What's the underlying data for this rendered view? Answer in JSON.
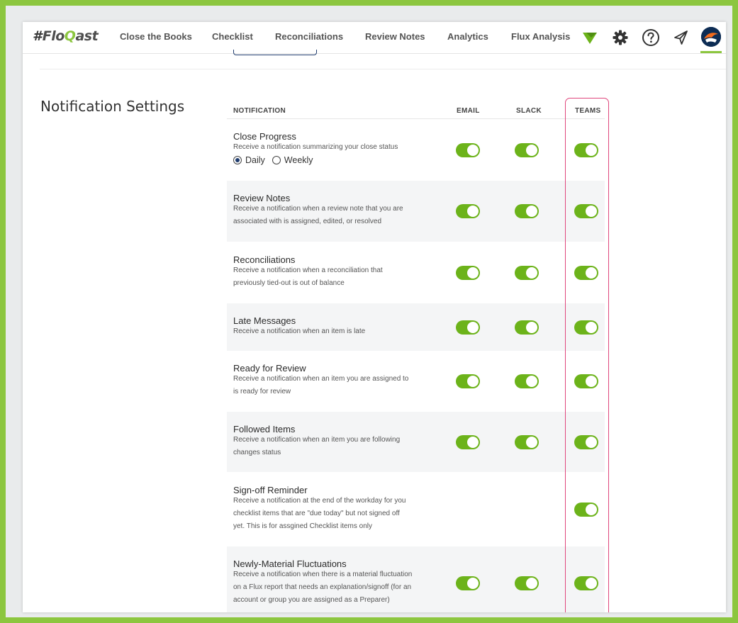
{
  "app": {
    "logo_text_prefix": "#",
    "logo_text_main": "Flo",
    "logo_text_q": "Q",
    "logo_text_rest": "ast"
  },
  "nav": {
    "items": [
      "Close the Books",
      "Checklist",
      "Reconciliations",
      "Review Notes",
      "Analytics",
      "Flux Analysis"
    ],
    "icons": [
      "floqast-chevron-icon",
      "gear-icon",
      "help-icon",
      "send-icon",
      "avatar"
    ]
  },
  "page": {
    "section_title": "Notification Settings"
  },
  "table": {
    "headers": {
      "notification": "NOTIFICATION",
      "email": "EMAIL",
      "slack": "SLACK",
      "teams": "TEAMS"
    },
    "rows": [
      {
        "title": "Close Progress",
        "desc_lines": [
          "Receive a notification summarizing your close status"
        ],
        "radios": [
          {
            "label": "Daily",
            "selected": true
          },
          {
            "label": "Weekly",
            "selected": false
          }
        ],
        "email": true,
        "slack": true,
        "teams": true
      },
      {
        "title": "Review Notes",
        "desc_lines": [
          "Receive a notification when a review note that you are",
          "associated with is assigned, edited, or resolved"
        ],
        "email": true,
        "slack": true,
        "teams": true
      },
      {
        "title": "Reconciliations",
        "desc_lines": [
          "Receive a notification when a reconciliation that",
          "previously tied-out is out of balance"
        ],
        "email": true,
        "slack": true,
        "teams": true
      },
      {
        "title": "Late Messages",
        "desc_lines": [
          "Receive a notification when an item is late"
        ],
        "email": true,
        "slack": true,
        "teams": true
      },
      {
        "title": "Ready for Review",
        "desc_lines": [
          "Receive a notification when an item you are assigned to",
          "is ready for review"
        ],
        "email": true,
        "slack": true,
        "teams": true
      },
      {
        "title": "Followed Items",
        "desc_lines": [
          "Receive a notification when an item you are following",
          "changes status"
        ],
        "email": true,
        "slack": true,
        "teams": true
      },
      {
        "title": "Sign-off Reminder",
        "desc_lines": [
          "Receive a notification at the end of the workday for you",
          "checklist items that are \"due today\" but not signed off",
          "yet. This is for assgined Checklist items only"
        ],
        "email": null,
        "slack": null,
        "teams": true
      },
      {
        "title": "Newly-Material Fluctuations",
        "desc_lines": [
          "Receive a notification when there is a material fluctuation",
          "on a Flux report that needs an explanation/signoff (for an",
          "account or group you are assigned as a Preparer)"
        ],
        "email": true,
        "slack": true,
        "teams": true
      }
    ]
  },
  "colors": {
    "accent_green": "#8cc63f",
    "toggle_on": "#6cb31a",
    "highlight": "#e0467c",
    "navy": "#1f3c6e"
  }
}
